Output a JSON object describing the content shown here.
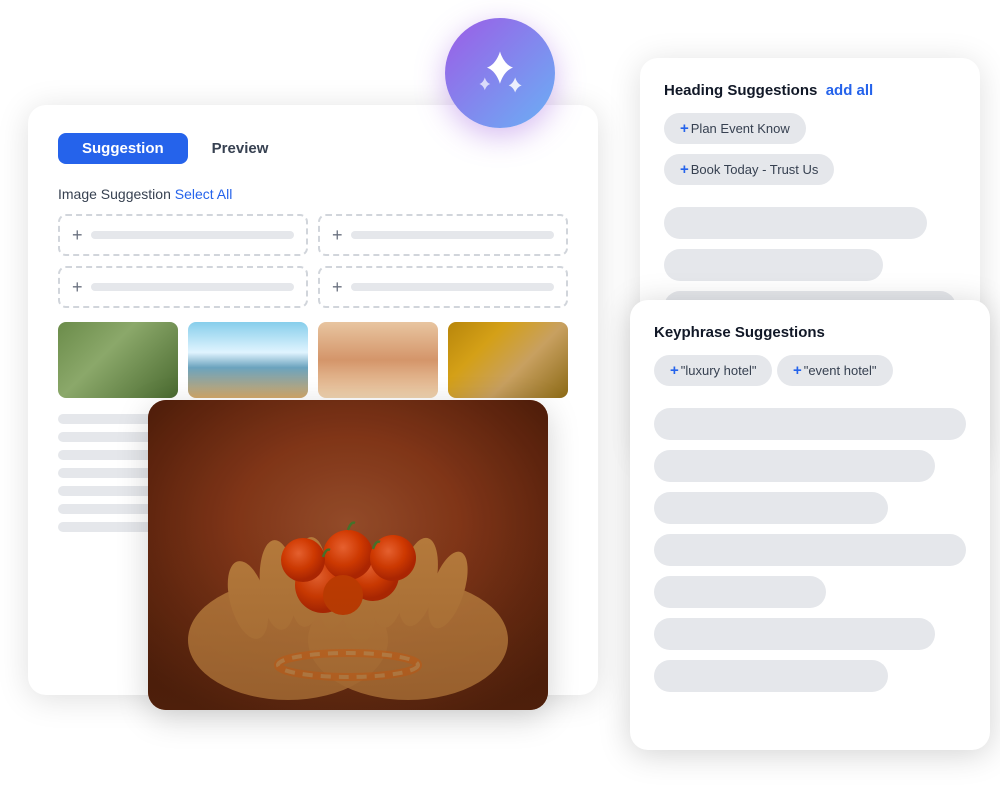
{
  "ai_icon": {
    "alt": "AI Sparkle Icon"
  },
  "main_card": {
    "tabs": [
      {
        "label": "Suggestion",
        "active": true
      },
      {
        "label": "Preview",
        "active": false
      }
    ],
    "image_section_label": "Image Suggestion",
    "image_section_link": "Select All",
    "slots": [
      {
        "plus": "+"
      },
      {
        "plus": "+"
      },
      {
        "plus": "+"
      },
      {
        "plus": "+"
      }
    ],
    "thumbnails": [
      {
        "alt": "nature thumbnail"
      },
      {
        "alt": "beach thumbnail"
      },
      {
        "alt": "wedding thumbnail"
      },
      {
        "alt": "hotel lobby thumbnail"
      }
    ]
  },
  "heading_card": {
    "title": "Heading Suggestions",
    "add_all_label": "add all",
    "suggestions": [
      {
        "label": "+ Plan Event Know"
      },
      {
        "label": "+ Book Today - Trust Us"
      }
    ],
    "skeleton_count": 5
  },
  "keyphrase_card": {
    "title": "Keyphrase Suggestions",
    "suggestions": [
      {
        "label": "+ \"luxury hotel\""
      },
      {
        "label": "+ \"event hotel\""
      }
    ],
    "skeleton_count": 7
  },
  "big_image": {
    "alt": "Hands holding tomatoes"
  }
}
